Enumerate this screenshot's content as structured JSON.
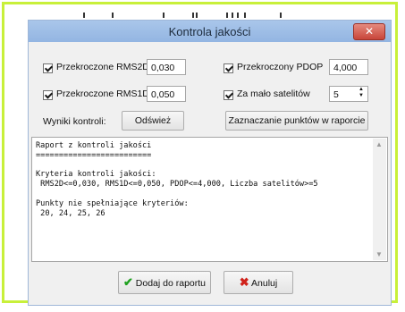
{
  "dialog": {
    "title": "Kontrola jakości"
  },
  "filters": {
    "rms2d": {
      "label": "Przekroczone RMS2D",
      "value": "0,030"
    },
    "pdop": {
      "label": "Przekroczony PDOP",
      "value": "4,000"
    },
    "rms1d": {
      "label": "Przekroczone RMS1D",
      "value": "0,050"
    },
    "sat": {
      "label": "Za mało satelitów",
      "value": "5"
    }
  },
  "results": {
    "label": "Wyniki kontroli:",
    "refresh_label": "Odśwież",
    "mark_label": "Zaznaczanie punktów w raporcie"
  },
  "report": {
    "lines": [
      "Raport z kontroli jakości",
      "=========================",
      "",
      "Kryteria kontroli jakości:",
      " RMS2D<=0,030, RMS1D<=0,050, PDOP<=4,000, Liczba satelitów>=5",
      "",
      "Punkty nie spełniające kryteriów:",
      " 20, 24, 25, 26"
    ]
  },
  "footer": {
    "add_label": "Dodaj do raportu",
    "cancel_label": "Anuluj"
  },
  "icons": {
    "close": "close-icon",
    "add": "checkmark-icon",
    "cancel": "x-icon"
  },
  "colors": {
    "frame_accent": "#c8f03a",
    "titlebar": "#a9c6ea",
    "close_button": "#c8453a"
  }
}
